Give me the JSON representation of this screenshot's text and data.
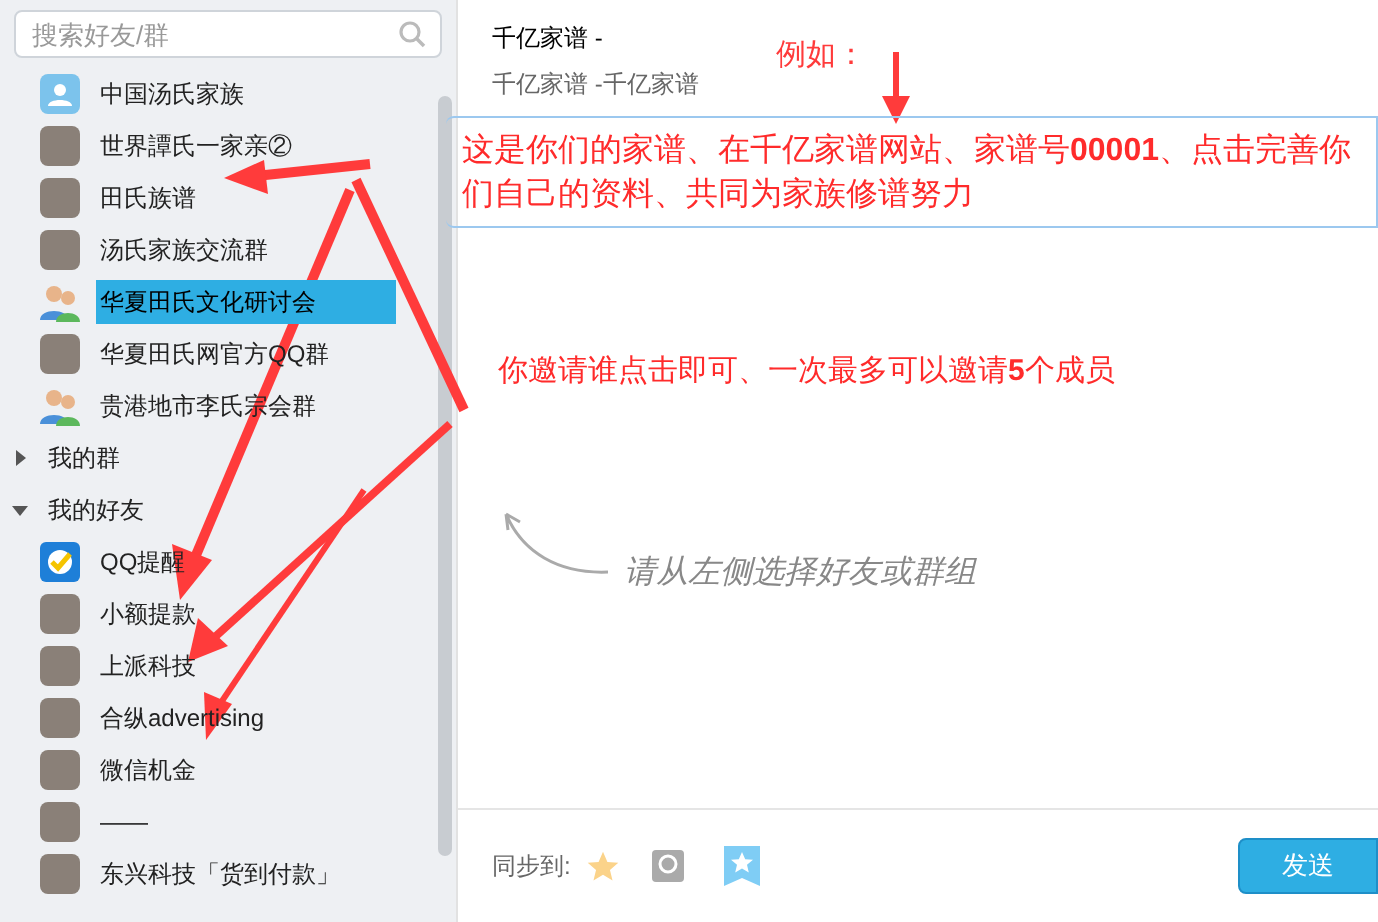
{
  "sidebar": {
    "search": {
      "placeholder": "搜索好友/群"
    },
    "groups": [
      {
        "name": "中国汤氏家族",
        "kind": "group",
        "selected": false
      },
      {
        "name": "世界譚氏一家亲②",
        "kind": "photo",
        "selected": false
      },
      {
        "name": "田氏族谱",
        "kind": "photo",
        "selected": false
      },
      {
        "name": "汤氏家族交流群",
        "kind": "photo",
        "selected": false
      },
      {
        "name": "华夏田氏文化研讨会",
        "kind": "people",
        "selected": true
      },
      {
        "name": "华夏田氏网官方QQ群",
        "kind": "photo",
        "selected": false
      },
      {
        "name": "贵港地市李氏宗会群",
        "kind": "people",
        "selected": false
      }
    ],
    "sections": [
      {
        "label": "我的群",
        "expanded": false
      },
      {
        "label": "我的好友",
        "expanded": true
      }
    ],
    "friends": [
      {
        "name": "QQ提醒",
        "kind": "check",
        "selected": false
      },
      {
        "name": "小额提款",
        "kind": "photo",
        "selected": false
      },
      {
        "name": "上派科技",
        "kind": "photo",
        "selected": false
      },
      {
        "name": "合纵advertising",
        "kind": "photo",
        "selected": false
      },
      {
        "name": "微信机金",
        "kind": "photo",
        "selected": false
      },
      {
        "name": "——",
        "kind": "photo",
        "selected": false
      },
      {
        "name": "东兴科技「货到付款」",
        "kind": "photo",
        "selected": false
      }
    ]
  },
  "share": {
    "title": "千亿家谱 -",
    "subtitle": "千亿家谱 -千亿家谱",
    "hint": "请从左侧选择好友或群组",
    "sync_label": "同步到:",
    "send_button": "发送"
  },
  "annotations": {
    "example_label": "例如：",
    "note_1": "这是你们的家谱、在千亿家谱网站、家谱号**00001**、点击完善你们自己的资料、共同为家族修谱努力",
    "note_2": "你邀请谁点击即可、一次最多可以邀请**5**个成员"
  }
}
